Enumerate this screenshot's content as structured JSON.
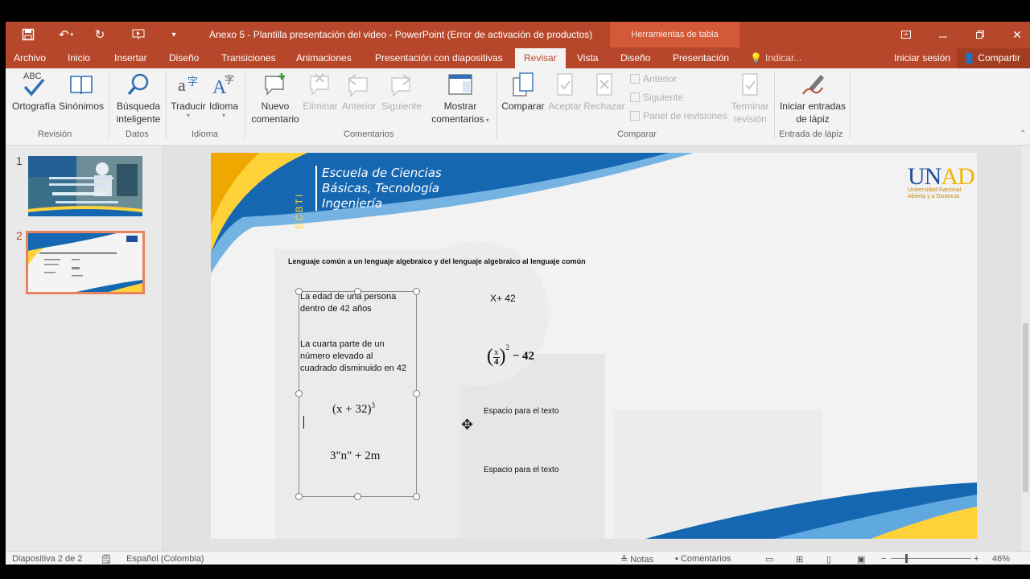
{
  "titlebar": {
    "title": "Anexo 5 - Plantilla presentación del video - PowerPoint (Error de activación de productos)",
    "context_tab": "Herramientas de tabla"
  },
  "tabs": [
    "Archivo",
    "Inicio",
    "Insertar",
    "Diseño",
    "Transiciones",
    "Animaciones",
    "Presentación con diapositivas",
    "Revisar",
    "Vista",
    "Diseño",
    "Presentación"
  ],
  "active_tab": "Revisar",
  "tell_me": "Indicar...",
  "signin": "Iniciar sesión",
  "share": "Compartir",
  "ribbon": {
    "ortografia": "Ortografía",
    "sinonimos": "Sinónimos",
    "busqueda_1": "Búsqueda",
    "busqueda_2": "inteligente",
    "traducir": "Traducir",
    "idioma": "Idioma",
    "nuevo_1": "Nuevo",
    "nuevo_2": "comentario",
    "eliminar": "Eliminar",
    "anterior": "Anterior",
    "siguiente": "Siguiente",
    "mostrar_1": "Mostrar",
    "mostrar_2": "comentarios",
    "comparar": "Comparar",
    "aceptar": "Aceptar",
    "rechazar": "Rechazar",
    "small_anterior": "Anterior",
    "small_siguiente": "Siguiente",
    "small_panel": "Panel de revisiones",
    "terminar_1": "Terminar",
    "terminar_2": "revisión",
    "iniciar_1": "Iniciar entradas",
    "iniciar_2": "de lápiz",
    "abc": "ABC",
    "groups": {
      "revision": "Revisión",
      "datos": "Datos",
      "idioma": "Idioma",
      "comentarios": "Comentarios",
      "comparar": "Comparar",
      "lapiz": "Entrada de lápiz"
    }
  },
  "thumbnails": [
    {
      "number": "1"
    },
    {
      "number": "2"
    }
  ],
  "slide": {
    "school_lines": [
      "Escuela de Ciencias",
      "Básicas, Tecnología",
      "Ingeniería"
    ],
    "ecbti": "ECBTI",
    "unad_u": "U",
    "unad_n": "N",
    "unad_ad": "AD",
    "unad_sub_1": "Universidad Nacional",
    "unad_sub_2": "Abierta y a Distancia",
    "heading": "Lenguaje común a un lenguaje algebraico y del lenguaje algebraico al lenguaje común",
    "text1_1": "La edad de una persona",
    "text1_2": "dentro de 42 años",
    "text2_1": "La cuarta parte de un",
    "text2_2": "número elevado al",
    "text2_3": "cuadrado disminuido en 42",
    "eq_x42": "X+ 42",
    "eq_frac_x": "x",
    "eq_frac_4": "4",
    "eq_frac_exp": "2",
    "eq_frac_rest": "− 42",
    "eq_cube_1": "(x + 32)",
    "eq_cube_exp": "3",
    "eq_3n": "3\"n\" + 2m",
    "placeholder1": "Espacio para el texto",
    "placeholder2": "Espacio para el texto"
  },
  "status": {
    "slide": "Diapositiva 2 de 2",
    "lang": "Español (Colombia)",
    "notas": "Notas",
    "comentarios": "Comentarios",
    "zoom": "46%"
  },
  "colors": {
    "accent": "#b7472a",
    "ribbon": "#f3f3f3",
    "slide_blue": "#1467b0",
    "slide_yellow": "#ffd23a"
  }
}
